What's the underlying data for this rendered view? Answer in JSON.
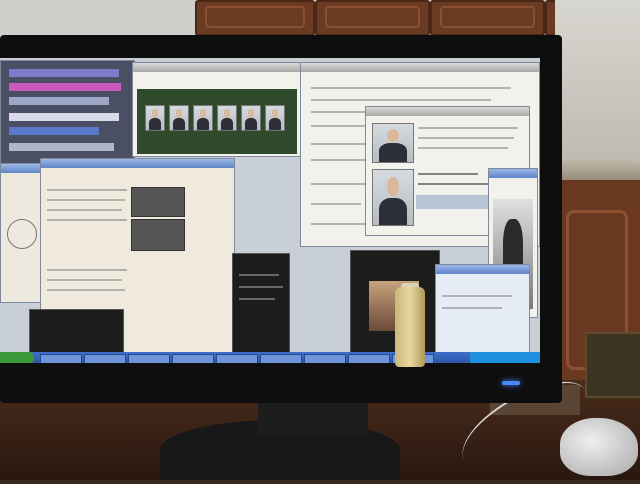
{
  "scene": {
    "kind": "photo of a computer monitor on a desk showing many overlapping application windows",
    "colors": {
      "bezel": "#0e0e0e",
      "taskbar": "#2b56a8",
      "start_button": "#3a9a3a",
      "power_led": "#4a86ff",
      "wood": "#6b3a22"
    },
    "icons": [
      "power-led-icon",
      "computer-mouse-icon"
    ]
  }
}
